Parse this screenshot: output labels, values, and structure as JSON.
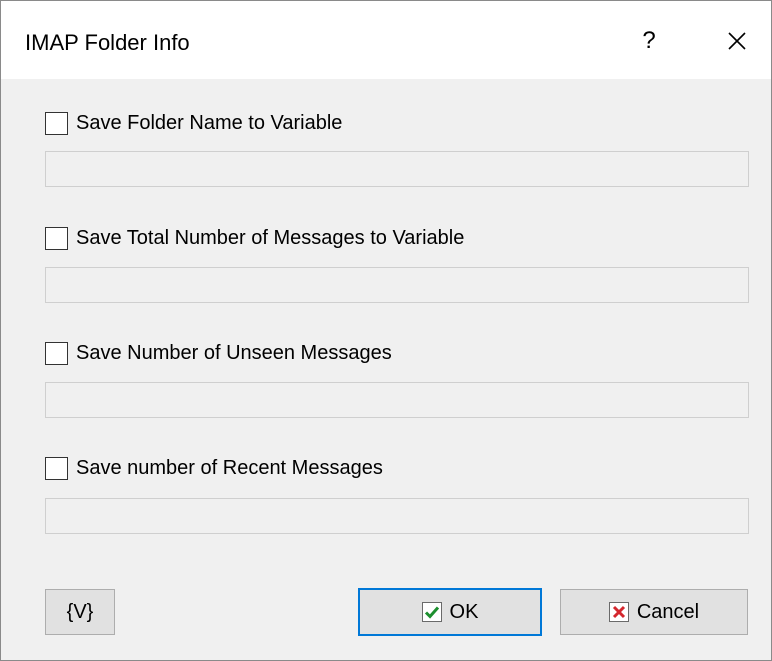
{
  "window": {
    "title": "IMAP Folder Info",
    "help_label": "?"
  },
  "options": [
    {
      "label": "Save Folder Name to Variable",
      "checked": false,
      "value": "",
      "placeholder": ""
    },
    {
      "label": "Save Total Number of Messages to Variable",
      "checked": false,
      "value": "",
      "placeholder": ""
    },
    {
      "label": "Save Number of Unseen Messages",
      "checked": false,
      "value": "",
      "placeholder": ""
    },
    {
      "label": "Save number of Recent Messages",
      "checked": false,
      "value": "",
      "placeholder": ""
    }
  ],
  "footer": {
    "variables_label": "{V}",
    "ok_label": "OK",
    "cancel_label": "Cancel"
  },
  "colors": {
    "accent": "#0078d7",
    "ok_check": "#1c8f2e",
    "cancel_x": "#d4272e"
  },
  "icons": {
    "ok": "check-icon",
    "cancel": "x-icon",
    "close": "close-icon"
  }
}
